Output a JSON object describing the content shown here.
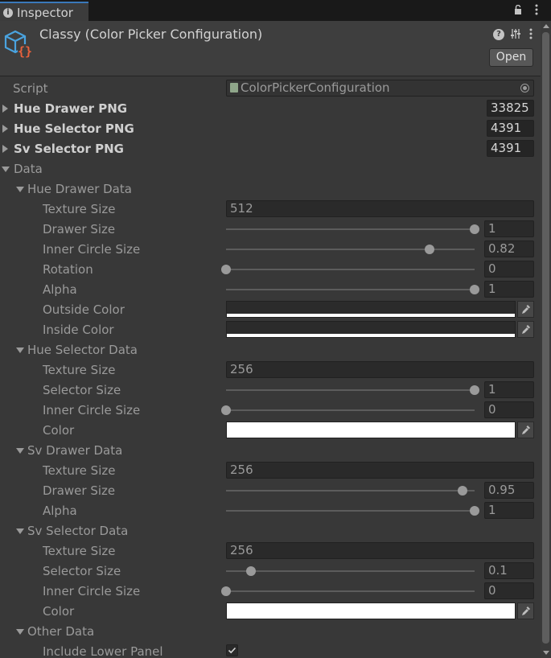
{
  "tab": {
    "label": "Inspector"
  },
  "header": {
    "title": "Classy (Color Picker Configuration)",
    "open_label": "Open"
  },
  "props": {
    "script": {
      "label": "Script",
      "value": "ColorPickerConfiguration"
    },
    "hue_drawer_png": {
      "label": "Hue Drawer PNG",
      "value": "33825"
    },
    "hue_selector_png": {
      "label": "Hue Selector PNG",
      "value": "4391"
    },
    "sv_selector_png": {
      "label": "Sv Selector PNG",
      "value": "4391"
    },
    "data": {
      "label": "Data"
    },
    "hue_drawer_data": {
      "label": "Hue Drawer Data",
      "texture_size": {
        "label": "Texture Size",
        "value": "512"
      },
      "drawer_size": {
        "label": "Drawer Size",
        "value": "1",
        "fraction": 1.0
      },
      "inner_circle_size": {
        "label": "Inner Circle Size",
        "value": "0.82",
        "fraction": 0.82
      },
      "rotation": {
        "label": "Rotation",
        "value": "0",
        "fraction": 0.0
      },
      "alpha": {
        "label": "Alpha",
        "value": "1",
        "fraction": 1.0
      },
      "outside_color": {
        "label": "Outside Color",
        "color": "#ffffff"
      },
      "inside_color": {
        "label": "Inside Color",
        "color": "#ffffff"
      }
    },
    "hue_selector_data": {
      "label": "Hue Selector Data",
      "texture_size": {
        "label": "Texture Size",
        "value": "256"
      },
      "selector_size": {
        "label": "Selector Size",
        "value": "1",
        "fraction": 1.0
      },
      "inner_circle_size": {
        "label": "Inner Circle Size",
        "value": "0",
        "fraction": 0.0
      },
      "color": {
        "label": "Color",
        "color": "#ffffff"
      }
    },
    "sv_drawer_data": {
      "label": "Sv Drawer Data",
      "texture_size": {
        "label": "Texture Size",
        "value": "256"
      },
      "drawer_size": {
        "label": "Drawer Size",
        "value": "0.95",
        "fraction": 0.95
      },
      "alpha": {
        "label": "Alpha",
        "value": "1",
        "fraction": 1.0
      }
    },
    "sv_selector_data": {
      "label": "Sv Selector Data",
      "texture_size": {
        "label": "Texture Size",
        "value": "256"
      },
      "selector_size": {
        "label": "Selector Size",
        "value": "0.1",
        "fraction": 0.1
      },
      "inner_circle_size": {
        "label": "Inner Circle Size",
        "value": "0",
        "fraction": 0.0
      },
      "color": {
        "label": "Color",
        "color": "#ffffff"
      }
    },
    "other_data": {
      "label": "Other Data",
      "include_lower_panel": {
        "label": "Include Lower Panel",
        "checked": true
      }
    }
  },
  "icons": {
    "tab": "info-icon",
    "lock": "lock-icon",
    "menu": "kebab-menu-icon",
    "asset": "scriptable-object-icon",
    "help": "help-icon",
    "presets": "presets-icon",
    "picker": "eyedropper-icon",
    "slider": "slider-knob",
    "target": "object-picker-icon"
  },
  "colors": {
    "background": "#383838",
    "header": "#3e3e3e",
    "tab_accent": "#3a79bb",
    "asset_icon_cube": "#4aa3df",
    "asset_icon_braces": "#e8613c"
  }
}
